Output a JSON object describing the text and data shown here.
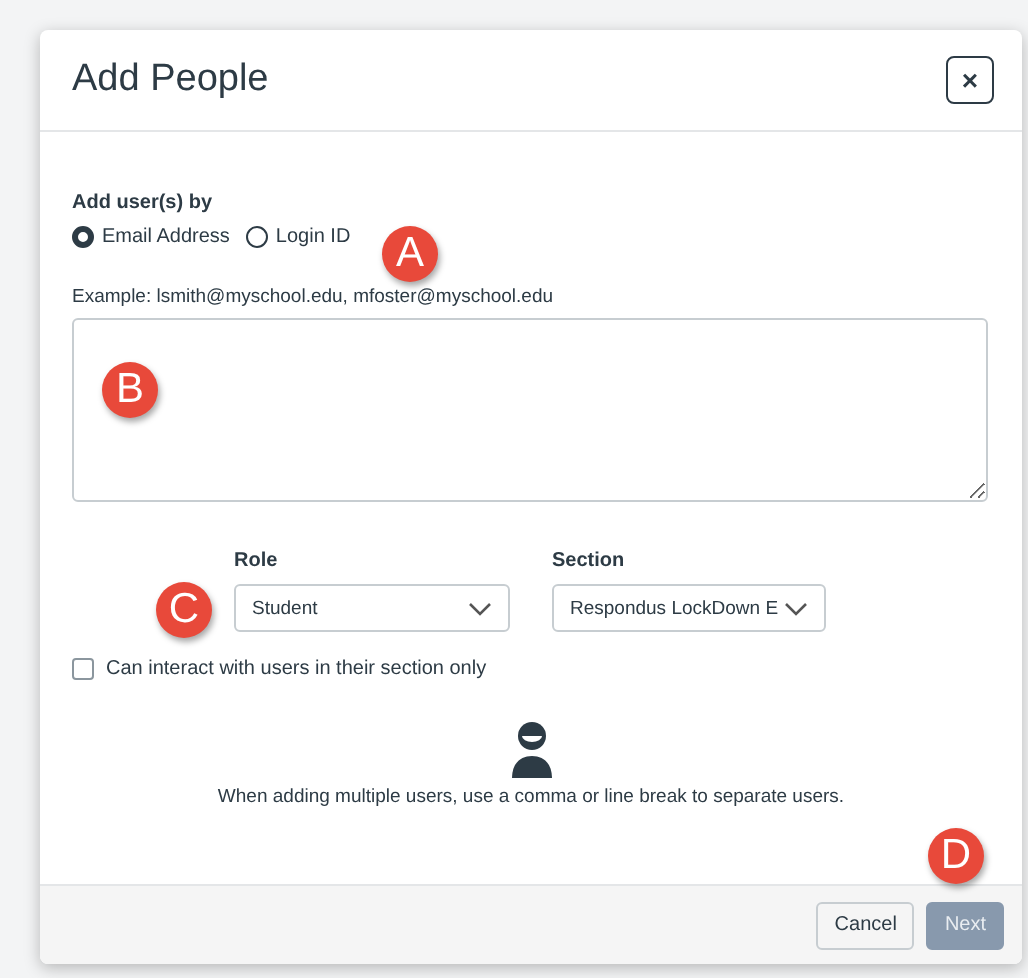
{
  "dialog": {
    "title": "Add People",
    "close": "×"
  },
  "add_by": {
    "label": "Add user(s) by",
    "options": [
      {
        "label": "Email Address",
        "selected": true
      },
      {
        "label": "Login ID",
        "selected": false
      }
    ]
  },
  "example": "Example: lsmith@myschool.edu, mfoster@myschool.edu",
  "role": {
    "label": "Role",
    "value": "Student"
  },
  "section": {
    "label": "Section",
    "value": "Respondus LockDown E"
  },
  "section_only": {
    "label": "Can interact with users in their section only",
    "checked": false
  },
  "help_text": "When adding multiple users, use a comma or line break to separate users.",
  "buttons": [
    {
      "label": "Cancel",
      "kind": "secondary"
    },
    {
      "label": "Next",
      "kind": "primary"
    }
  ],
  "annotations": [
    "A",
    "B",
    "C",
    "D"
  ]
}
